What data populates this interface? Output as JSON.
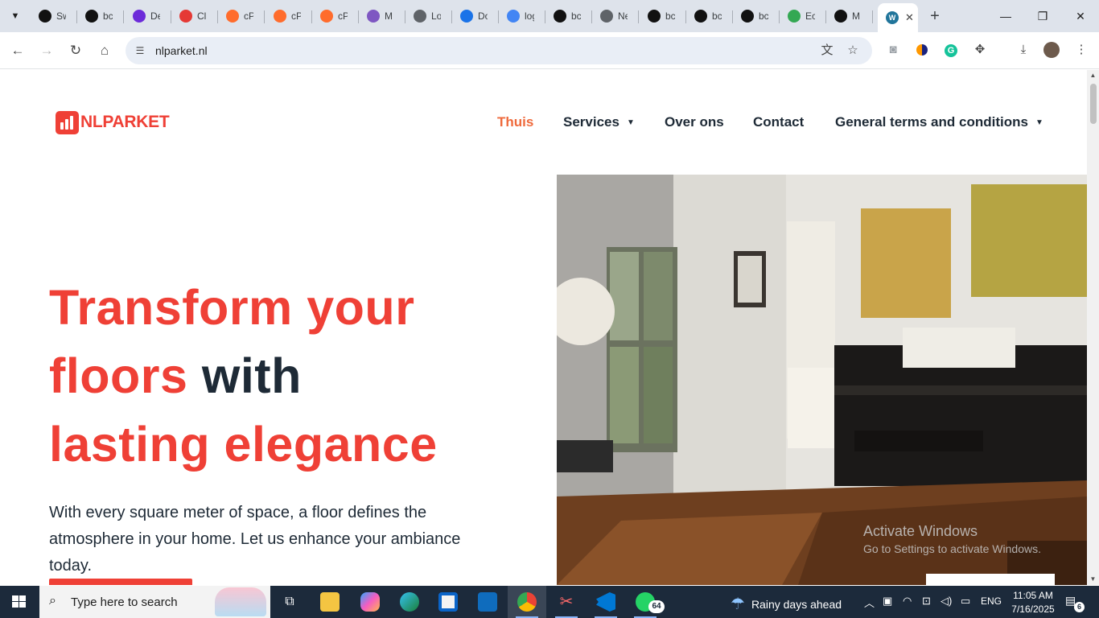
{
  "browser": {
    "tabs": [
      {
        "title": "Sw",
        "icon": "openai-icon",
        "color": "#111111"
      },
      {
        "title": "bc",
        "icon": "github-icon",
        "color": "#111111"
      },
      {
        "title": "De",
        "icon": "p-logo-icon",
        "color": "#6c2bd9"
      },
      {
        "title": "Cl",
        "icon": "k-logo-icon",
        "color": "#e53935"
      },
      {
        "title": "cP",
        "icon": "cpanel-icon",
        "color": "#ff6c2c"
      },
      {
        "title": "cP",
        "icon": "cpanel-icon",
        "color": "#ff6c2c"
      },
      {
        "title": "cP",
        "icon": "cpanel-icon",
        "color": "#ff6c2c"
      },
      {
        "title": "M",
        "icon": "copilot-icon",
        "color": "#7e57c2"
      },
      {
        "title": "Lo",
        "icon": "globe-icon",
        "color": "#5f6368"
      },
      {
        "title": "Do",
        "icon": "download-icon",
        "color": "#1a73e8"
      },
      {
        "title": "log",
        "icon": "google-icon",
        "color": "#4285f4"
      },
      {
        "title": "bc",
        "icon": "github-icon",
        "color": "#111111"
      },
      {
        "title": "Ne",
        "icon": "chrome-icon",
        "color": "#5f6368"
      },
      {
        "title": "bc",
        "icon": "github-icon",
        "color": "#111111"
      },
      {
        "title": "bc",
        "icon": "github-icon",
        "color": "#111111"
      },
      {
        "title": "bc",
        "icon": "github-icon",
        "color": "#111111"
      },
      {
        "title": "Ec",
        "icon": "green-circle-icon",
        "color": "#34a853"
      },
      {
        "title": "M",
        "icon": "triangle-logo-icon",
        "color": "#111111"
      }
    ],
    "active_tab": {
      "icon": "wordpress-icon",
      "close": "✕"
    },
    "new_tab": "+",
    "window": {
      "minimize": "—",
      "restore": "❐",
      "close": "✕"
    },
    "url": "nlparket.nl"
  },
  "site": {
    "logo_text": "NLPARKET",
    "nav": [
      {
        "label": "Thuis",
        "dropdown": false,
        "active": true
      },
      {
        "label": "Services",
        "dropdown": true,
        "active": false
      },
      {
        "label": "Over ons",
        "dropdown": false,
        "active": false
      },
      {
        "label": "Contact",
        "dropdown": false,
        "active": false
      },
      {
        "label": "General terms and conditions",
        "dropdown": true,
        "active": false
      }
    ],
    "hero": {
      "title_red_1": "Transform your",
      "title_red_2": "floors",
      "title_dark": "with",
      "title_red_3": "lasting elegance",
      "text": "With every square meter of space, a floor defines the atmosphere in your home. Let us enhance your ambiance today."
    },
    "watermark": {
      "line1": "Activate Windows",
      "line2": "Go to Settings to activate Windows."
    },
    "colors": {
      "accent": "#ef4036",
      "nav_active": "#ef6a3c",
      "dark": "#1e2a36"
    }
  },
  "taskbar": {
    "search_placeholder": "Type here to search",
    "whatsapp_badge": "64",
    "weather": "Rainy days ahead",
    "language": "ENG",
    "time": "11:05 AM",
    "date": "7/16/2025",
    "notifications": "6"
  }
}
